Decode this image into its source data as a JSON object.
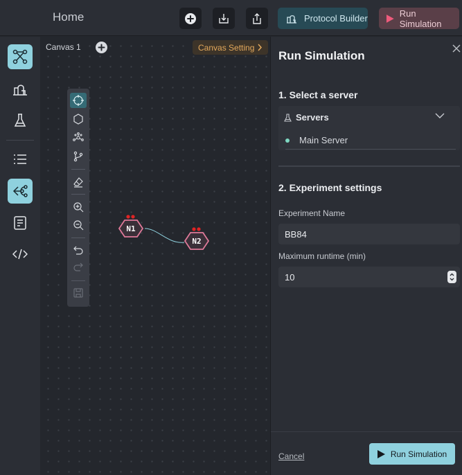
{
  "header": {
    "title": "Home",
    "protocol_builder_label": "Protocol Builder",
    "run_simulation_label": "Run Simulation"
  },
  "sidebar": {
    "items": [
      {
        "icon": "topology-icon",
        "active": true
      },
      {
        "icon": "protocol-icon",
        "active": false
      },
      {
        "icon": "flask-icon",
        "active": false
      },
      {
        "icon": "list-icon",
        "active": false
      },
      {
        "icon": "tree-icon",
        "active": true
      },
      {
        "icon": "document-icon",
        "active": false
      },
      {
        "icon": "code-icon",
        "active": false
      }
    ]
  },
  "canvas": {
    "tab_label": "Canvas 1",
    "setting_label": "Canvas Setting",
    "nodes": [
      {
        "label": "N1"
      },
      {
        "label": "N2"
      }
    ]
  },
  "panel": {
    "title": "Run Simulation",
    "section1_title": "1. Select a server",
    "servers_label": "Servers",
    "servers": [
      "Main Server"
    ],
    "section2_title": "2. Experiment settings",
    "experiment_name_label": "Experiment Name",
    "experiment_name_value": "BB84",
    "max_runtime_label": "Maximum runtime (min)",
    "max_runtime_value": "10",
    "cancel_label": "Cancel",
    "run_label": "Run Simulation"
  },
  "colors": {
    "accent": "#8fd1de",
    "node_border": "#e07a9a",
    "node_fill": "#3a2f38",
    "warning": "#e3a85c"
  }
}
